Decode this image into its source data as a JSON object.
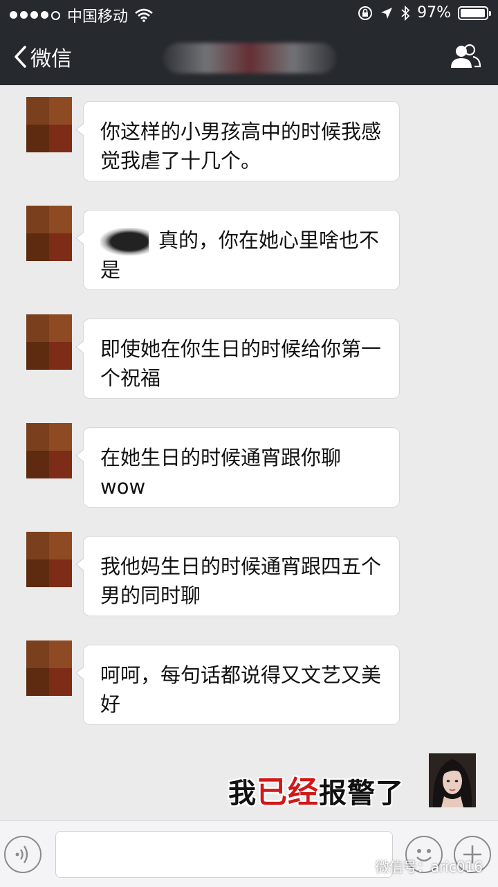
{
  "status_bar": {
    "carrier": "中国移动",
    "battery": "97%",
    "battery_fraction": 0.97
  },
  "nav": {
    "back_label": "微信"
  },
  "messages": [
    {
      "text": "你这样的小男孩高中的时候我感觉我虐了十几个。"
    },
    {
      "text": "真的，你在她心里啥也不是"
    },
    {
      "text": "即使她在你生日的时候给你第一个祝福"
    },
    {
      "text": "在她生日的时候通宵跟你聊wow"
    },
    {
      "text": "我他妈生日的时候通宵跟四五个男的同时聊"
    },
    {
      "text": "呵呵，每句话都说得又文艺又美好"
    }
  ],
  "caption": {
    "part1": "我",
    "part2": "已经",
    "part3": "报警了"
  },
  "watermark": "微信号：aric016",
  "icons": [
    "wifi-icon",
    "location-icon",
    "bluetooth-icon",
    "battery-icon",
    "back-chevron-icon",
    "contacts-icon",
    "voice-icon",
    "emoji-icon",
    "plus-icon",
    "wechat-logo-icon"
  ],
  "colors": {
    "nav_bg": "#26292e",
    "chat_bg": "#ebebeb",
    "caption_red": "#d21818"
  }
}
